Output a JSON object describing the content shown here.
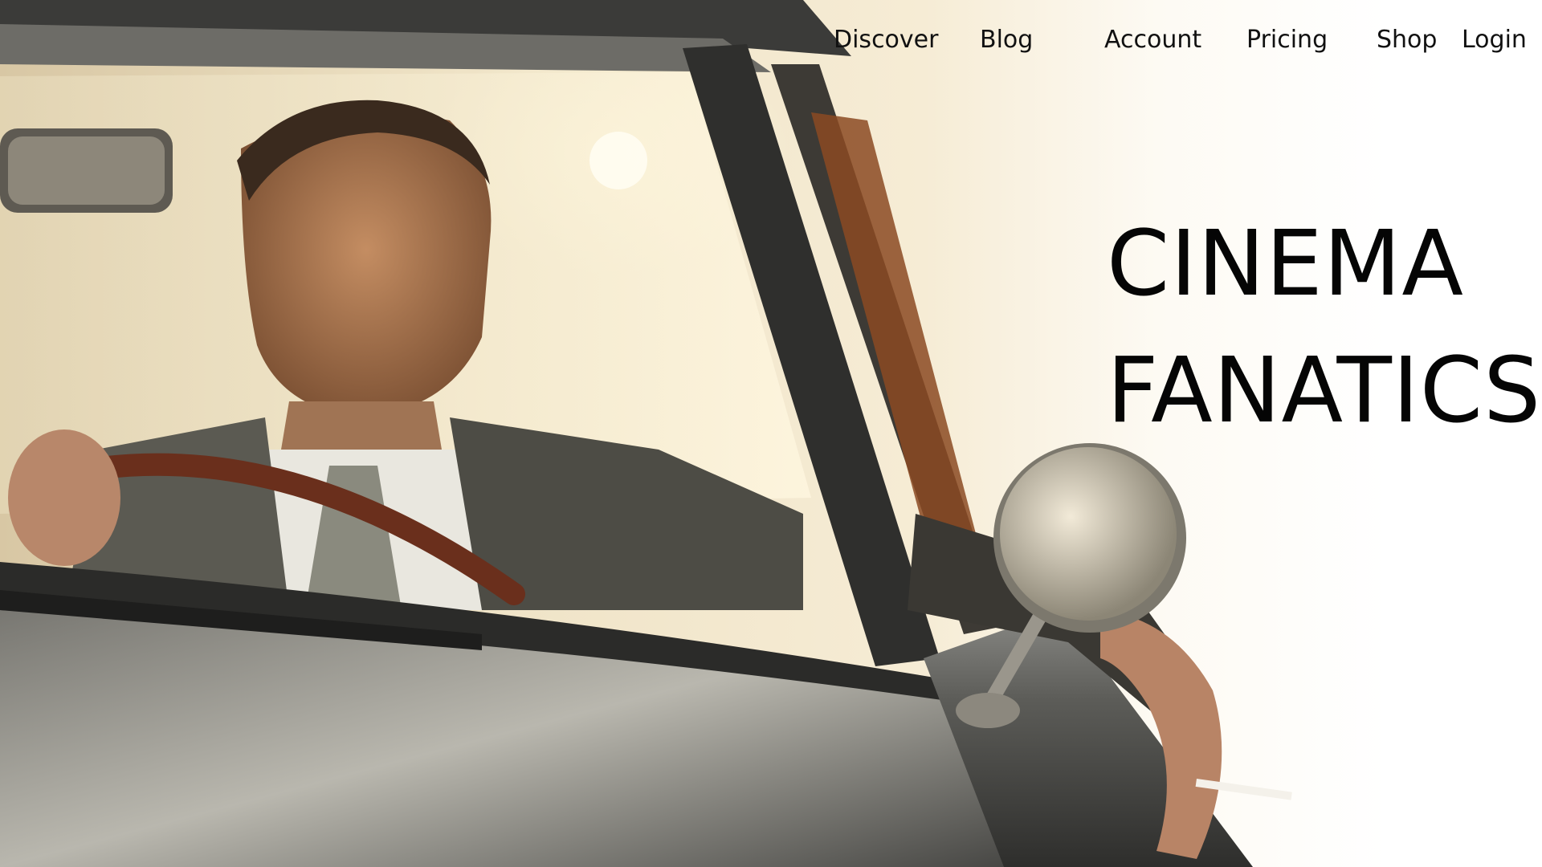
{
  "nav": {
    "items": [
      {
        "label": "Discover"
      },
      {
        "label": "Blog"
      },
      {
        "label": "Account"
      },
      {
        "label": "Pricing"
      },
      {
        "label": "Shop"
      },
      {
        "label": "Login"
      }
    ]
  },
  "hero": {
    "title_line1": "CINEMA",
    "title_line2": "FANATICS",
    "image": "man-driving-classic-car-photo"
  },
  "colors": {
    "text": "#111111",
    "background": "#ffffff",
    "car_body": "#4a4a4a",
    "warm_light": "#f6ecd5"
  }
}
